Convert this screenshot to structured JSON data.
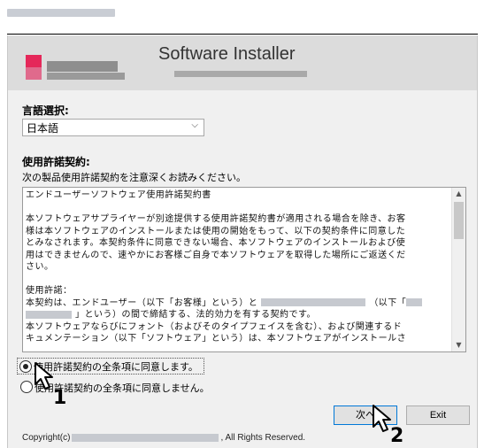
{
  "installer": {
    "title": "Software Installer"
  },
  "language": {
    "label": "言語選択:",
    "selected": "日本語"
  },
  "license": {
    "label": "使用許諾契約:",
    "instruction": "次の製品使用許諾契約を注意深くお読みください。",
    "lines": [
      "エンドユーザーソフトウェア使用許諾契約書",
      "",
      "本ソフトウェアサプライヤーが別途提供する使用許諾契約書が適用される場合を除き、お客",
      "様は本ソフトウェアのインストールまたは使用の開始をもって、以下の契約条件に同意した",
      "とみなされます。本契約条件に同意できない場合、本ソフトウェアのインストールおよび使",
      "用はできませんので、速やかにお客様ご自身で本ソフトウェアを取得した場所にご返送くだ",
      "さい。",
      "",
      "使用許諾："
    ],
    "line10_a": "本契約は、エンドユーザー（以下「お客様」という）と",
    "line10_b": "（以下「",
    "line11_a": "」という）の間で締結する、法的効力を有する契約です。",
    "line12": "本ソフトウェアならびにフォント（およびそのタイプフェイスを含む）、および関連するド",
    "line13": "キュメンテーション（以下「ソフトウェア」という）は、本ソフトウェアがインストールさ"
  },
  "options": {
    "agree": "使用許諾契約の全条項に同意します。",
    "disagree": "使用許諾契約の全条項に同意しません。",
    "agree_selected": true
  },
  "buttons": {
    "next": "次へ",
    "exit": "Exit"
  },
  "footer": {
    "copyright_prefix": "Copyright(c)",
    "copyright_suffix": ", All Rights Reserved."
  },
  "annotations": {
    "step1": "1",
    "step2": "2"
  }
}
